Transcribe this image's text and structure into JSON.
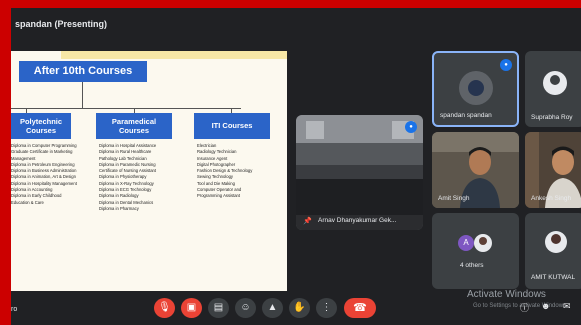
{
  "meeting": {
    "presenter_label": "spandan (Presenting)",
    "self_label": "ro"
  },
  "slide": {
    "title": "After 10th Courses",
    "columns": [
      {
        "heading_line1": "Polytechnic",
        "heading_line2": "Courses",
        "items": [
          "Diploma in Computer Programming",
          "Graduate Certificate in Marketing",
          "Management",
          "Diploma in Petroleum Engineering",
          "Diploma in Business Administration",
          "Diploma in Animation, Art & Design",
          "Diploma in Hospitality Management",
          "Diploma in Accounting",
          "Diploma in Early Childhood",
          "Education & Care"
        ]
      },
      {
        "heading_line1": "Paramedical",
        "heading_line2": "Courses",
        "items": [
          "Diploma in Hospital Assistance",
          "Diploma in Rural Healthcare",
          "Pathology Lab Technician",
          "Diploma in Paramedic Nursing",
          "Certificate of Nursing Assistant",
          "Diploma in Physiotherapy",
          "Diploma in X-Ray Technology",
          "Diploma in ECG Technology",
          "Diploma in Radiology",
          "Diploma in Dental Mechanics",
          "Diploma in Pharmacy"
        ]
      },
      {
        "heading_line1": "ITI Courses",
        "heading_line2": "",
        "items": [
          "Electrician",
          "Radiology Technician",
          "Insurance Agent",
          "Digital Photographer",
          "Fashion Design & Technology",
          "Sewing Technology",
          "Tool and Die Making",
          "Computer Operator and",
          "Programming Assistant"
        ]
      }
    ]
  },
  "participants": {
    "pinned_name": "Arnav Dhanyakumar Gek...",
    "tiles": [
      {
        "name": "spandan spandan"
      },
      {
        "name": "Suprabha Roy"
      },
      {
        "name": "Amit Singh"
      },
      {
        "name": "Ankesh Singh"
      },
      {
        "name": "4 others",
        "initial": "A"
      },
      {
        "name": "AMIT KUTWAL"
      }
    ]
  },
  "watermark": {
    "line1": "Activate Windows",
    "line2": "Go to Settings to activate Windows."
  },
  "controls": {
    "mic_icon": "mic-off-icon",
    "cam_icon": "camera-off-icon",
    "end_icon": "phone-hangup-icon"
  },
  "colors": {
    "slide_accent": "#2b64c8",
    "danger": "#ea4335",
    "tile_bg": "#3c4043",
    "active_border": "#8ab4f8"
  }
}
